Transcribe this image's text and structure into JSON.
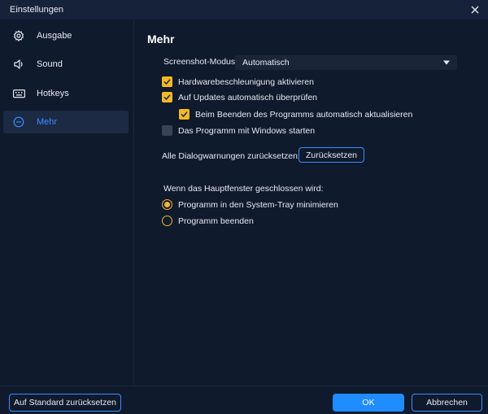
{
  "window": {
    "title": "Einstellungen"
  },
  "sidebar": {
    "items": [
      {
        "label": "Ausgabe",
        "icon": "gear-icon",
        "active": false
      },
      {
        "label": "Sound",
        "icon": "speaker-icon",
        "active": false
      },
      {
        "label": "Hotkeys",
        "icon": "keyboard-icon",
        "active": false
      },
      {
        "label": "Mehr",
        "icon": "more-icon",
        "active": true
      }
    ]
  },
  "main": {
    "heading": "Mehr",
    "screenshot_mode": {
      "label": "Screenshot-Modus:",
      "value": "Automatisch"
    },
    "checkboxes": [
      {
        "label": "Hardwarebeschleunigung aktivieren",
        "checked": true
      },
      {
        "label": "Auf Updates automatisch überprüfen",
        "checked": true
      },
      {
        "label": "Beim Beenden des Programms automatisch aktualisieren",
        "checked": true
      },
      {
        "label": "Das Programm mit Windows starten",
        "checked": false
      }
    ],
    "dialog_warnings": {
      "label": "Alle Dialogwarnungen zurücksetzen:",
      "button": "Zurücksetzen"
    },
    "close_behavior": {
      "label": "Wenn das Hauptfenster geschlossen wird:",
      "options": [
        {
          "label": "Programm in den System-Tray minimieren",
          "selected": true
        },
        {
          "label": "Programm beenden",
          "selected": false
        }
      ]
    }
  },
  "footer": {
    "reset_label": "Auf Standard zurücksetzen",
    "ok_label": "OK",
    "cancel_label": "Abbrechen"
  },
  "colors": {
    "background": "#0f1a2d",
    "accent_blue": "#1f8cff",
    "checkbox_yellow": "#f3b824",
    "active_nav": "#1c2a44"
  }
}
